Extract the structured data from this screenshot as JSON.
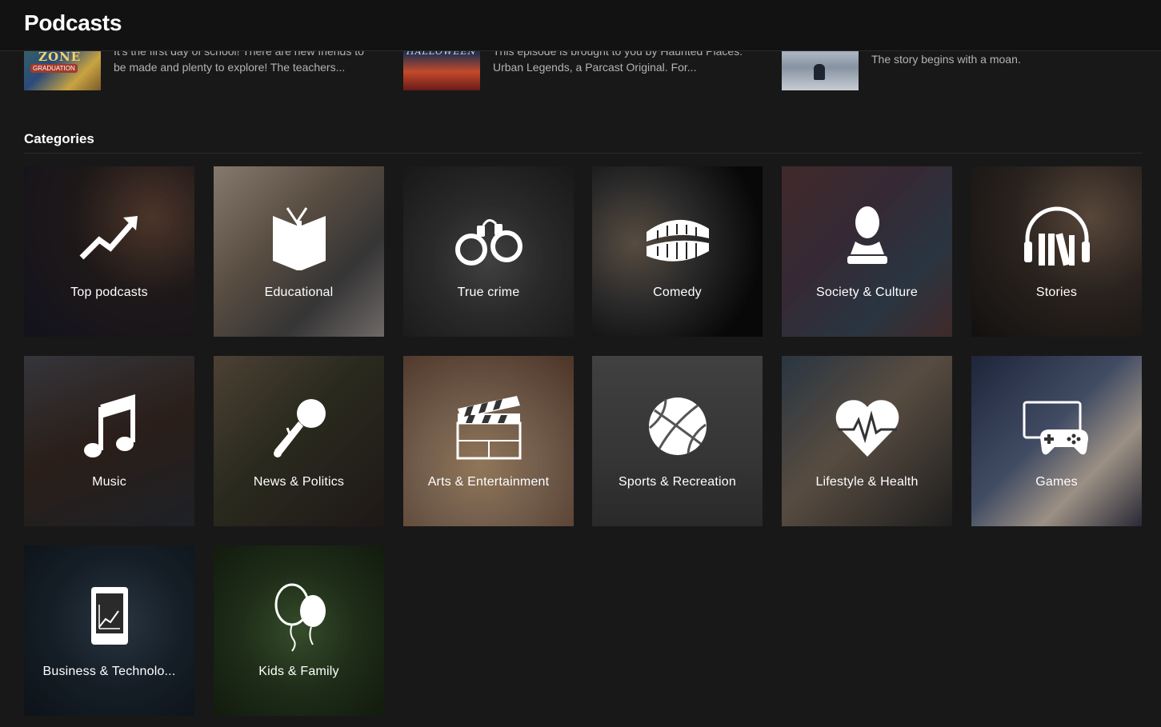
{
  "header": {
    "title": "Podcasts"
  },
  "episodes": [
    {
      "description": "It's the first day of school! There are new friends to be made and plenty to explore! The teachers...",
      "thumb_text": "ZONE",
      "thumb_subtext": "GRADUATION"
    },
    {
      "description": "This episode is brought to you by Haunted Places: Urban Legends, a Parcast Original. For...",
      "thumb_text": "HALLOWEEN"
    },
    {
      "description": "The story begins with a moan."
    }
  ],
  "categories": {
    "title": "Categories",
    "items": [
      {
        "label": "Top podcasts",
        "icon": "trending-up-icon"
      },
      {
        "label": "Educational",
        "icon": "book-icon"
      },
      {
        "label": "True crime",
        "icon": "handcuffs-icon"
      },
      {
        "label": "Comedy",
        "icon": "chattering-teeth-icon"
      },
      {
        "label": "Society & Culture",
        "icon": "bust-icon"
      },
      {
        "label": "Stories",
        "icon": "headphones-books-icon"
      },
      {
        "label": "Music",
        "icon": "music-note-icon"
      },
      {
        "label": "News & Politics",
        "icon": "microphone-icon"
      },
      {
        "label": "Arts & Entertainment",
        "icon": "clapperboard-icon"
      },
      {
        "label": "Sports & Recreation",
        "icon": "basketball-icon"
      },
      {
        "label": "Lifestyle & Health",
        "icon": "heartbeat-icon"
      },
      {
        "label": "Games",
        "icon": "gamepad-icon"
      },
      {
        "label": "Business & Technolo...",
        "icon": "tablet-chart-icon"
      },
      {
        "label": "Kids & Family",
        "icon": "balloons-icon"
      }
    ]
  }
}
